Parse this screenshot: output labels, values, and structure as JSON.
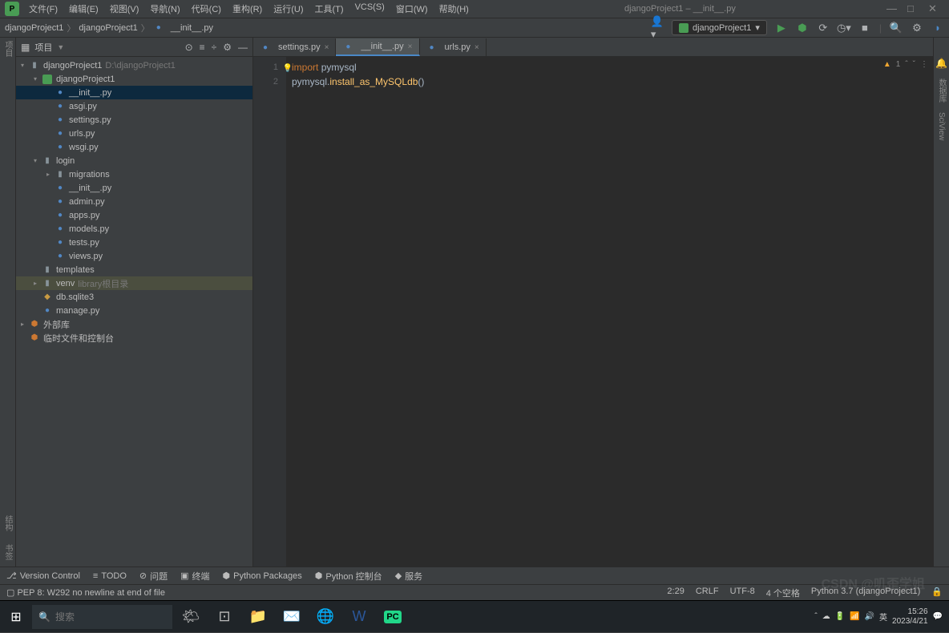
{
  "title": "djangoProject1 – __init__.py",
  "menu": [
    "文件(F)",
    "编辑(E)",
    "视图(V)",
    "导航(N)",
    "代码(C)",
    "重构(R)",
    "运行(U)",
    "工具(T)",
    "VCS(S)",
    "窗口(W)",
    "帮助(H)"
  ],
  "breadcrumb": [
    "djangoProject1",
    "djangoProject1",
    "__init__.py"
  ],
  "runConfig": "djangoProject1",
  "panel": {
    "title": "项目"
  },
  "tree": [
    {
      "d": 0,
      "a": "v",
      "i": "folder",
      "t": "djangoProject1",
      "h": "D:\\djangoProject1"
    },
    {
      "d": 1,
      "a": "v",
      "i": "djproj",
      "t": "djangoProject1"
    },
    {
      "d": 2,
      "a": "",
      "i": "py",
      "t": "__init__.py",
      "sel": true
    },
    {
      "d": 2,
      "a": "",
      "i": "py",
      "t": "asgi.py"
    },
    {
      "d": 2,
      "a": "",
      "i": "py",
      "t": "settings.py"
    },
    {
      "d": 2,
      "a": "",
      "i": "py",
      "t": "urls.py"
    },
    {
      "d": 2,
      "a": "",
      "i": "py",
      "t": "wsgi.py"
    },
    {
      "d": 1,
      "a": "v",
      "i": "folder",
      "t": "login"
    },
    {
      "d": 2,
      "a": ">",
      "i": "folder",
      "t": "migrations"
    },
    {
      "d": 2,
      "a": "",
      "i": "py",
      "t": "__init__.py"
    },
    {
      "d": 2,
      "a": "",
      "i": "py",
      "t": "admin.py"
    },
    {
      "d": 2,
      "a": "",
      "i": "py",
      "t": "apps.py"
    },
    {
      "d": 2,
      "a": "",
      "i": "py",
      "t": "models.py"
    },
    {
      "d": 2,
      "a": "",
      "i": "py",
      "t": "tests.py"
    },
    {
      "d": 2,
      "a": "",
      "i": "py",
      "t": "views.py"
    },
    {
      "d": 1,
      "a": "",
      "i": "folder",
      "t": "templates"
    },
    {
      "d": 1,
      "a": ">",
      "i": "folder",
      "t": "venv",
      "h": "library根目录",
      "ctx": true
    },
    {
      "d": 1,
      "a": "",
      "i": "db",
      "t": "db.sqlite3"
    },
    {
      "d": 1,
      "a": "",
      "i": "py",
      "t": "manage.py"
    },
    {
      "d": 0,
      "a": ">",
      "i": "lib",
      "t": "外部库"
    },
    {
      "d": 0,
      "a": "",
      "i": "lib",
      "t": "临时文件和控制台"
    }
  ],
  "tabs": [
    {
      "label": "settings.py",
      "active": false
    },
    {
      "label": "__init__.py",
      "active": true
    },
    {
      "label": "urls.py",
      "active": false
    }
  ],
  "code": {
    "lines": [
      "1",
      "2"
    ],
    "l1": {
      "kw": "import",
      "id": "pymysql"
    },
    "l2": {
      "id1": "pymysql",
      "fn": "install_as_MySQLdb",
      "paren": "()"
    }
  },
  "editorInfo": {
    "warn": "1"
  },
  "bottom": [
    "Version Control",
    "TODO",
    "问题",
    "终端",
    "Python Packages",
    "Python 控制台",
    "服务"
  ],
  "status": {
    "left": "PEP 8: W292 no newline at end of file",
    "pos": "2:29",
    "eol": "CRLF",
    "enc": "UTF-8",
    "indent": "4 个空格",
    "sdk": "Python 3.7 (djangoProject1)"
  },
  "rightRail": [
    "通知",
    "数据库",
    "SciView"
  ],
  "leftRail": [
    "项目",
    "结构",
    "书签"
  ],
  "taskbar": {
    "searchPlaceholder": "搜索",
    "ime": "英",
    "time": "15:26",
    "date": "2023/4/21",
    "watermark": "CSDN @叽歪学姐"
  }
}
